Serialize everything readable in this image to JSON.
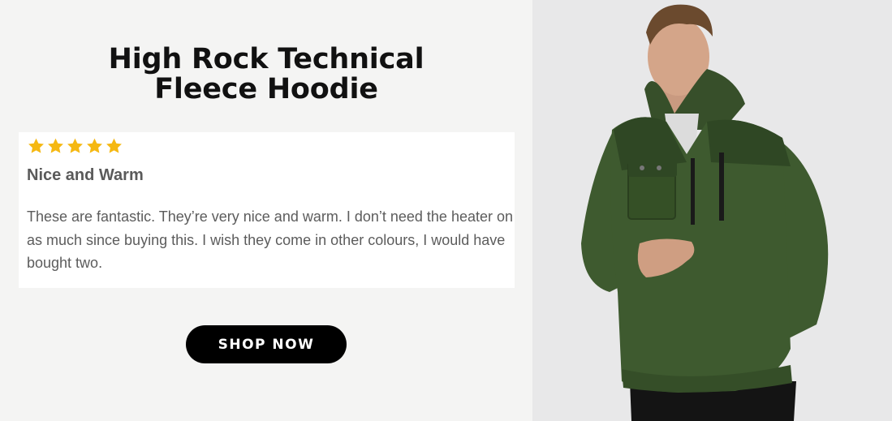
{
  "product": {
    "title_line1": "High Rock Technical",
    "title_line2": "Fleece Hoodie"
  },
  "review": {
    "rating": 5,
    "rating_max": 5,
    "star_color": "#f5b812",
    "title": "Nice and Warm",
    "body": "These are fantastic. They’re very nice and warm. I don’t need the heater on as much since buying this. I wish they come in other colours, I would have bought two."
  },
  "cta": {
    "label": "SHOP NOW"
  },
  "photo": {
    "icon": "product-photo-icon",
    "hoodie_color": "#3e5a2f"
  }
}
